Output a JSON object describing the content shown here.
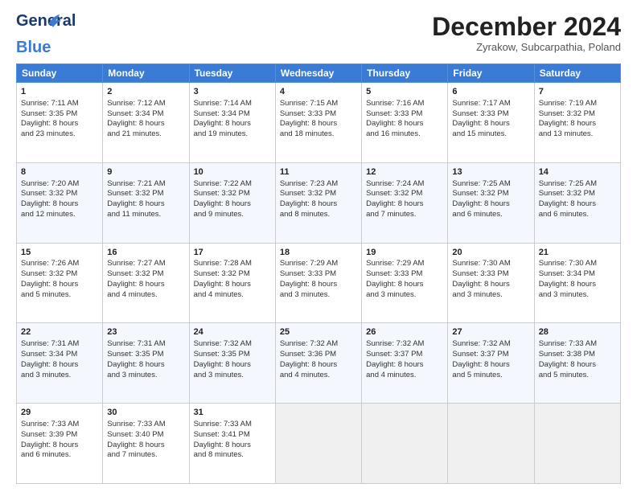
{
  "logo": {
    "line1": "General",
    "line2": "Blue"
  },
  "title": "December 2024",
  "subtitle": "Zyrakow, Subcarpathia, Poland",
  "headers": [
    "Sunday",
    "Monday",
    "Tuesday",
    "Wednesday",
    "Thursday",
    "Friday",
    "Saturday"
  ],
  "weeks": [
    [
      {
        "day": "1",
        "lines": [
          "Sunrise: 7:11 AM",
          "Sunset: 3:35 PM",
          "Daylight: 8 hours",
          "and 23 minutes."
        ]
      },
      {
        "day": "2",
        "lines": [
          "Sunrise: 7:12 AM",
          "Sunset: 3:34 PM",
          "Daylight: 8 hours",
          "and 21 minutes."
        ]
      },
      {
        "day": "3",
        "lines": [
          "Sunrise: 7:14 AM",
          "Sunset: 3:34 PM",
          "Daylight: 8 hours",
          "and 19 minutes."
        ]
      },
      {
        "day": "4",
        "lines": [
          "Sunrise: 7:15 AM",
          "Sunset: 3:33 PM",
          "Daylight: 8 hours",
          "and 18 minutes."
        ]
      },
      {
        "day": "5",
        "lines": [
          "Sunrise: 7:16 AM",
          "Sunset: 3:33 PM",
          "Daylight: 8 hours",
          "and 16 minutes."
        ]
      },
      {
        "day": "6",
        "lines": [
          "Sunrise: 7:17 AM",
          "Sunset: 3:33 PM",
          "Daylight: 8 hours",
          "and 15 minutes."
        ]
      },
      {
        "day": "7",
        "lines": [
          "Sunrise: 7:19 AM",
          "Sunset: 3:32 PM",
          "Daylight: 8 hours",
          "and 13 minutes."
        ]
      }
    ],
    [
      {
        "day": "8",
        "lines": [
          "Sunrise: 7:20 AM",
          "Sunset: 3:32 PM",
          "Daylight: 8 hours",
          "and 12 minutes."
        ]
      },
      {
        "day": "9",
        "lines": [
          "Sunrise: 7:21 AM",
          "Sunset: 3:32 PM",
          "Daylight: 8 hours",
          "and 11 minutes."
        ]
      },
      {
        "day": "10",
        "lines": [
          "Sunrise: 7:22 AM",
          "Sunset: 3:32 PM",
          "Daylight: 8 hours",
          "and 9 minutes."
        ]
      },
      {
        "day": "11",
        "lines": [
          "Sunrise: 7:23 AM",
          "Sunset: 3:32 PM",
          "Daylight: 8 hours",
          "and 8 minutes."
        ]
      },
      {
        "day": "12",
        "lines": [
          "Sunrise: 7:24 AM",
          "Sunset: 3:32 PM",
          "Daylight: 8 hours",
          "and 7 minutes."
        ]
      },
      {
        "day": "13",
        "lines": [
          "Sunrise: 7:25 AM",
          "Sunset: 3:32 PM",
          "Daylight: 8 hours",
          "and 6 minutes."
        ]
      },
      {
        "day": "14",
        "lines": [
          "Sunrise: 7:25 AM",
          "Sunset: 3:32 PM",
          "Daylight: 8 hours",
          "and 6 minutes."
        ]
      }
    ],
    [
      {
        "day": "15",
        "lines": [
          "Sunrise: 7:26 AM",
          "Sunset: 3:32 PM",
          "Daylight: 8 hours",
          "and 5 minutes."
        ]
      },
      {
        "day": "16",
        "lines": [
          "Sunrise: 7:27 AM",
          "Sunset: 3:32 PM",
          "Daylight: 8 hours",
          "and 4 minutes."
        ]
      },
      {
        "day": "17",
        "lines": [
          "Sunrise: 7:28 AM",
          "Sunset: 3:32 PM",
          "Daylight: 8 hours",
          "and 4 minutes."
        ]
      },
      {
        "day": "18",
        "lines": [
          "Sunrise: 7:29 AM",
          "Sunset: 3:33 PM",
          "Daylight: 8 hours",
          "and 3 minutes."
        ]
      },
      {
        "day": "19",
        "lines": [
          "Sunrise: 7:29 AM",
          "Sunset: 3:33 PM",
          "Daylight: 8 hours",
          "and 3 minutes."
        ]
      },
      {
        "day": "20",
        "lines": [
          "Sunrise: 7:30 AM",
          "Sunset: 3:33 PM",
          "Daylight: 8 hours",
          "and 3 minutes."
        ]
      },
      {
        "day": "21",
        "lines": [
          "Sunrise: 7:30 AM",
          "Sunset: 3:34 PM",
          "Daylight: 8 hours",
          "and 3 minutes."
        ]
      }
    ],
    [
      {
        "day": "22",
        "lines": [
          "Sunrise: 7:31 AM",
          "Sunset: 3:34 PM",
          "Daylight: 8 hours",
          "and 3 minutes."
        ]
      },
      {
        "day": "23",
        "lines": [
          "Sunrise: 7:31 AM",
          "Sunset: 3:35 PM",
          "Daylight: 8 hours",
          "and 3 minutes."
        ]
      },
      {
        "day": "24",
        "lines": [
          "Sunrise: 7:32 AM",
          "Sunset: 3:35 PM",
          "Daylight: 8 hours",
          "and 3 minutes."
        ]
      },
      {
        "day": "25",
        "lines": [
          "Sunrise: 7:32 AM",
          "Sunset: 3:36 PM",
          "Daylight: 8 hours",
          "and 4 minutes."
        ]
      },
      {
        "day": "26",
        "lines": [
          "Sunrise: 7:32 AM",
          "Sunset: 3:37 PM",
          "Daylight: 8 hours",
          "and 4 minutes."
        ]
      },
      {
        "day": "27",
        "lines": [
          "Sunrise: 7:32 AM",
          "Sunset: 3:37 PM",
          "Daylight: 8 hours",
          "and 5 minutes."
        ]
      },
      {
        "day": "28",
        "lines": [
          "Sunrise: 7:33 AM",
          "Sunset: 3:38 PM",
          "Daylight: 8 hours",
          "and 5 minutes."
        ]
      }
    ],
    [
      {
        "day": "29",
        "lines": [
          "Sunrise: 7:33 AM",
          "Sunset: 3:39 PM",
          "Daylight: 8 hours",
          "and 6 minutes."
        ]
      },
      {
        "day": "30",
        "lines": [
          "Sunrise: 7:33 AM",
          "Sunset: 3:40 PM",
          "Daylight: 8 hours",
          "and 7 minutes."
        ]
      },
      {
        "day": "31",
        "lines": [
          "Sunrise: 7:33 AM",
          "Sunset: 3:41 PM",
          "Daylight: 8 hours",
          "and 8 minutes."
        ]
      },
      null,
      null,
      null,
      null
    ]
  ]
}
